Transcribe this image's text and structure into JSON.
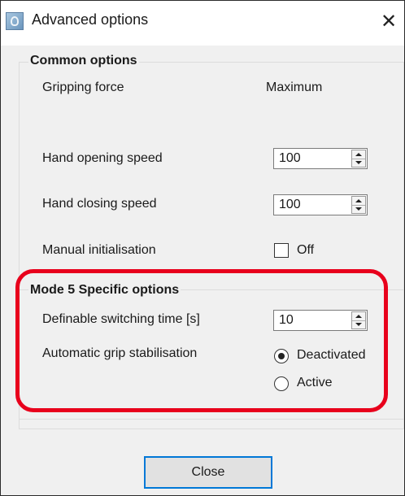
{
  "window": {
    "title": "Advanced options",
    "close_glyph": "✕"
  },
  "common_options": {
    "title": "Common options",
    "gripping_force": {
      "label": "Gripping force",
      "value": "Maximum"
    },
    "hand_opening_speed": {
      "label": "Hand opening speed",
      "value": "100"
    },
    "hand_closing_speed": {
      "label": "Hand closing speed",
      "value": "100"
    },
    "manual_initialisation": {
      "label": "Manual initialisation",
      "checkbox_label": "Off",
      "checked": false
    }
  },
  "mode5_options": {
    "title": "Mode 5 Specific options",
    "switching_time": {
      "label": "Definable switching time [s]",
      "value": "10"
    },
    "grip_stabilisation": {
      "label": "Automatic grip stabilisation",
      "options": [
        "Deactivated",
        "Active"
      ],
      "selected": "Deactivated"
    }
  },
  "footer": {
    "close_label": "Close"
  },
  "colors": {
    "highlight": "#e8001c",
    "button_focus_border": "#0078d7"
  },
  "icons": {
    "app": "app-icon",
    "close": "close-icon",
    "spin_up": "triangle-up-icon",
    "spin_down": "triangle-down-icon"
  }
}
